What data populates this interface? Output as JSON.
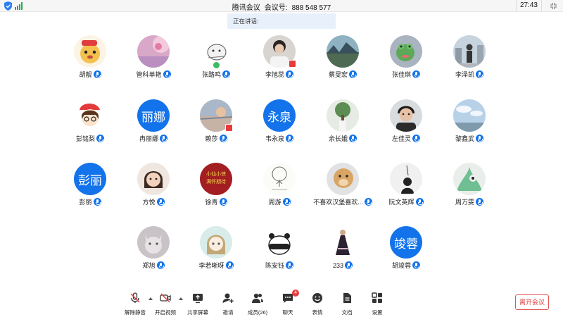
{
  "topbar": {
    "title": "腾讯会议",
    "meeting_id_label": "会议号:",
    "meeting_id": "888 548 577",
    "timer": "27:43"
  },
  "speaking_label": "正在讲话:",
  "participants": [
    {
      "name": "胡靓",
      "avatar": "cartoon-bear"
    },
    {
      "name": "管科单艳",
      "avatar": "pink-flower"
    },
    {
      "name": "张路鸣",
      "avatar": "cartoon-sketch",
      "badge": "green"
    },
    {
      "name": "李旭蕊",
      "avatar": "photo-person",
      "badge": "red"
    },
    {
      "name": "蔡旻宏",
      "avatar": "photo-landscape"
    },
    {
      "name": "张佳琪",
      "avatar": "frog-toy"
    },
    {
      "name": "李泽凯",
      "avatar": "photo-city"
    },
    {
      "name": "彭铭梨",
      "avatar": "cartoon-girl"
    },
    {
      "name": "冉丽娜",
      "avatar": "text",
      "initials": "丽娜"
    },
    {
      "name": "赖莎",
      "avatar": "photo-sunset",
      "badge": "red"
    },
    {
      "name": "韦永泉",
      "avatar": "text",
      "initials": "永泉"
    },
    {
      "name": "余长娥",
      "avatar": "photo-tree"
    },
    {
      "name": "左佳灵",
      "avatar": "photo-boy"
    },
    {
      "name": "黎鑫武",
      "avatar": "photo-sky"
    },
    {
      "name": "彭丽",
      "avatar": "text",
      "initials": "彭丽"
    },
    {
      "name": "方悦",
      "avatar": "photo-child"
    },
    {
      "name": "徐青",
      "avatar": "red-calligraphy"
    },
    {
      "name": "周游",
      "avatar": "tree-sketch"
    },
    {
      "name": "不喜欢汉堡喜欢...",
      "avatar": "photo-dog"
    },
    {
      "name": "阮文英辉",
      "avatar": "photo-silhouette"
    },
    {
      "name": "周万雯",
      "avatar": "photo-plant"
    },
    {
      "name": "郑旭",
      "avatar": "photo-kitten"
    },
    {
      "name": "李若晰呀",
      "avatar": "cartoon-anime"
    },
    {
      "name": "陈安钰",
      "avatar": "panda"
    },
    {
      "name": "233",
      "avatar": "figure-dress"
    },
    {
      "name": "胡竣蓉",
      "avatar": "text",
      "initials": "竣蓉"
    }
  ],
  "toolbar": {
    "mute": "解除静音",
    "video": "开启视频",
    "share": "共享屏幕",
    "invite": "邀请",
    "members": "成员(26)",
    "chat": "聊天",
    "chat_badge": "4",
    "emoji": "表情",
    "docs": "文档",
    "settings": "设置",
    "leave": "离开会议"
  },
  "colors": {
    "accent": "#1373eb",
    "leave": "#e23b3b",
    "signal": "#22b14c"
  }
}
